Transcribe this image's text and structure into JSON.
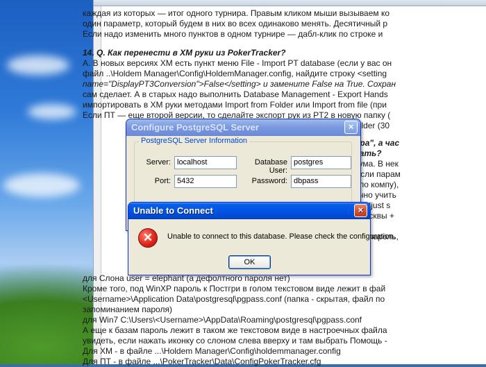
{
  "document": {
    "lines_top": [
      "каждая из которых — итог одного турнира. Правым кликом мыши вызываем ко",
      "один параметр, который будем в них во всех одинаково менять. Десятичный р",
      "Если надо изменить много пунктов в одном турнире — дабл-клик по строке и"
    ],
    "q14_title": "14. Q. Как перенести в ХМ руки из PokerTracker?",
    "q14_lines": [
      "A. В новых версиях ХМ есть пункт меню File - Import PT database (если у вас он",
      "файл ..\\Holdem Manager\\Config\\HoldemManager.config, найдите строку <setting",
      "name=\"DisplayPT3Conversion\">False</setting> и замените False на True. Сохран",
      "сам сделает. А в старых надо выполнить Database Management - Export Hands",
      "импортировать в ХМ руки методами Import from Folder или Import from file (при",
      "Если ПТ — еще второй версии, то сделайте экспорт рук из PT2 в новую папку (",
      "o File > save to a new folder (30"
    ],
    "q15_title_1": "ной сессии как \"вчера\", а час",
    "q15_title_2": "его компа. Что делать?",
    "q15_lines": [
      "а его пишет клиент рума. В нек",
      "те, например, - нет. Если парам",
      "на время (а вот тут - по компу),",
      "оих отчетах более точно учить",
      "имеется опция меню Adjust s",
      "), для ФуллТильта и Москвы +"
    ],
    "pw_line": "е менял дефолтный пароль,",
    "lines_bottom": [
      "для Слона user = elephant (а дефолтного пароля нет)",
      "Кроме того, под WinXP пароль к Постгри в голом текстовом виде лежит в фай",
      "<Username>\\Application Data\\postgresql\\pgpass.conf (папка - скрытая, файл по",
      "запоминанием пароля)",
      "для Win7 C:\\Users\\<Username>\\AppData\\Roaming\\postgresql\\pgpass.conf",
      "А еще к базам пароль лежит в таком же текстовом виде в настроечных файла",
      "увидеть, если нажать иконку со слоном слева вверху и там выбрать Помощь -",
      "Для ХМ - в файле ...\\Holdem Manager\\Config\\holdemmanager.config",
      "Для ПТ - в файле ...\\PokerTracker\\Data\\ConfigPokerTracker.cfg"
    ]
  },
  "config_dialog": {
    "title": "Configure PostgreSQL Server",
    "close_label": "×",
    "group_label": "PostgreSQL Server Information",
    "server_label": "Server:",
    "server_value": "localhost",
    "port_label": "Port:",
    "port_value": "5432",
    "db_user_label": "Database User:",
    "db_user_value": "postgres",
    "password_label": "Password:",
    "password_value": "dbpass"
  },
  "error_dialog": {
    "title": "Unable to Connect",
    "close_label": "×",
    "icon_glyph": "✕",
    "message": "Unable to connect to this database.  Please check the configuration.",
    "ok_label": "OK"
  },
  "colors": {
    "titlebar_active": "#0054e3",
    "close_red": "#d9532f",
    "dialog_face": "#ece9d8",
    "error_icon": "#e0261a"
  }
}
